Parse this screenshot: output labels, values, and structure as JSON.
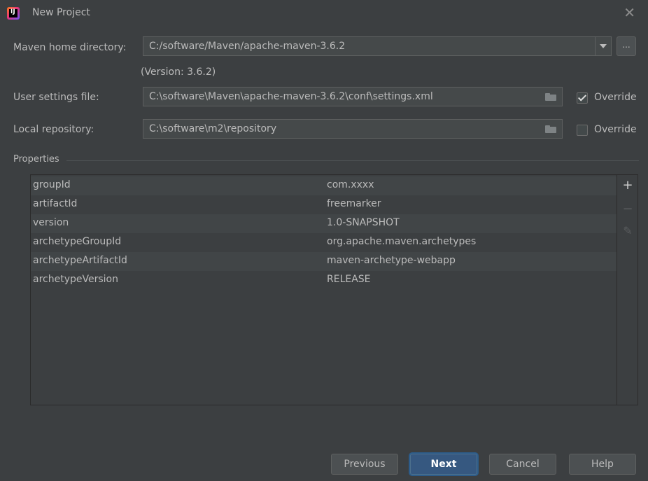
{
  "window": {
    "title": "New Project"
  },
  "maven_home": {
    "label": "Maven home directory:",
    "value": "C:/software/Maven/apache-maven-3.6.2",
    "browse_label": "...",
    "version_note": "(Version: 3.6.2)"
  },
  "user_settings": {
    "label": "User settings file:",
    "value": "C:\\software\\Maven\\apache-maven-3.6.2\\conf\\settings.xml",
    "override_label": "Override",
    "override_checked": true
  },
  "local_repository": {
    "label": "Local repository:",
    "value": "C:\\software\\m2\\repository",
    "override_label": "Override",
    "override_checked": false
  },
  "properties": {
    "title": "Properties",
    "rows": [
      {
        "key": "groupId",
        "value": "com.xxxx"
      },
      {
        "key": "artifactId",
        "value": "freemarker"
      },
      {
        "key": "version",
        "value": "1.0-SNAPSHOT"
      },
      {
        "key": "archetypeGroupId",
        "value": "org.apache.maven.archetypes"
      },
      {
        "key": "archetypeArtifactId",
        "value": "maven-archetype-webapp"
      },
      {
        "key": "archetypeVersion",
        "value": "RELEASE"
      }
    ],
    "tools": {
      "add": "+",
      "remove": "−",
      "edit": "✎"
    }
  },
  "buttons": {
    "previous": "Previous",
    "next": "Next",
    "cancel": "Cancel",
    "help": "Help"
  },
  "colors": {
    "background": "#3c3f41",
    "field": "#45494a",
    "primary": "#365880"
  }
}
